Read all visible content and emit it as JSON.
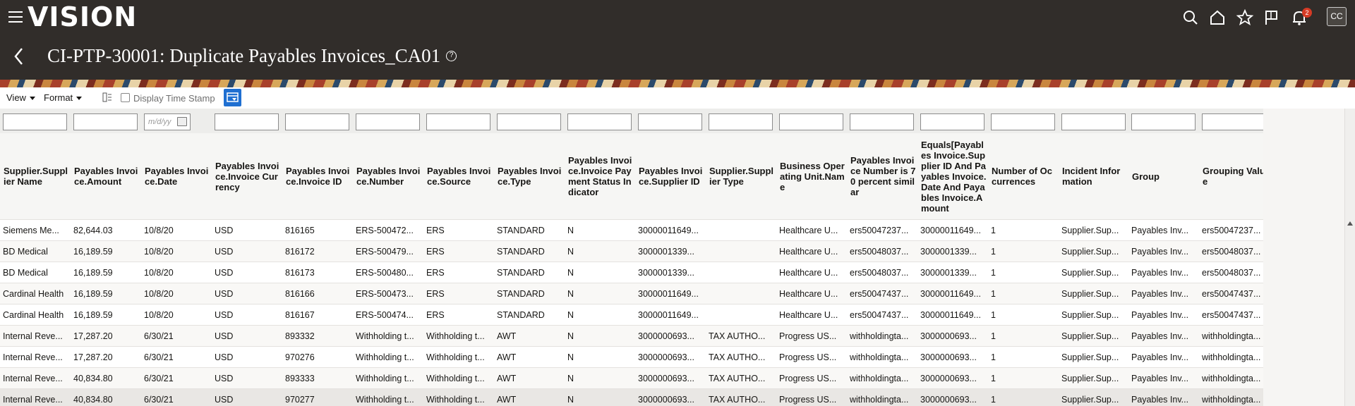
{
  "header": {
    "logo": "VISION",
    "title": "CI-PTP-30001: Duplicate Payables Invoices_CA01",
    "help_glyph": "?",
    "notification_count": "2",
    "avatar_initials": "CC"
  },
  "toolbar": {
    "view_label": "View",
    "format_label": "Format",
    "display_timestamp_label": "Display Time Stamp",
    "date_placeholder": "m/d/yy"
  },
  "table": {
    "columns": [
      "Supplier.Supplier Name",
      "Payables Invoice.Amount",
      "Payables Invoice.Date",
      "Payables Invoice.Invoice Currency",
      "Payables Invoice.Invoice ID",
      "Payables Invoice.Number",
      "Payables Invoice.Source",
      "Payables Invoice.Type",
      "Payables Invoice.Invoice Payment Status Indicator",
      "Payables Invoice.Supplier ID",
      "Supplier.Supplier Type",
      "Business Operating Unit.Name",
      "Payables Invoice Number is 70 percent similar",
      "Equals[Payables Invoice.Supplier ID And Payables Invoice.Date And Payables Invoice.Amount",
      "Number of Occurrences",
      "Incident Information",
      "Group",
      "Grouping Value"
    ],
    "rows": [
      [
        "Siemens Me...",
        "82,644.03",
        "10/8/20",
        "USD",
        "816165",
        "ERS-500472...",
        "ERS",
        "STANDARD",
        "N",
        "30000011649...",
        "",
        "Healthcare U...",
        "ers50047237...",
        "30000011649...",
        "1",
        "Supplier.Sup...",
        "Payables Inv...",
        "ers50047237..."
      ],
      [
        "BD Medical",
        "16,189.59",
        "10/8/20",
        "USD",
        "816172",
        "ERS-500479...",
        "ERS",
        "STANDARD",
        "N",
        "3000001339...",
        "",
        "Healthcare U...",
        "ers50048037...",
        "3000001339...",
        "1",
        "Supplier.Sup...",
        "Payables Inv...",
        "ers50048037..."
      ],
      [
        "BD Medical",
        "16,189.59",
        "10/8/20",
        "USD",
        "816173",
        "ERS-500480...",
        "ERS",
        "STANDARD",
        "N",
        "3000001339...",
        "",
        "Healthcare U...",
        "ers50048037...",
        "3000001339...",
        "1",
        "Supplier.Sup...",
        "Payables Inv...",
        "ers50048037..."
      ],
      [
        "Cardinal Health",
        "16,189.59",
        "10/8/20",
        "USD",
        "816166",
        "ERS-500473...",
        "ERS",
        "STANDARD",
        "N",
        "30000011649...",
        "",
        "Healthcare U...",
        "ers50047437...",
        "30000011649...",
        "1",
        "Supplier.Sup...",
        "Payables Inv...",
        "ers50047437..."
      ],
      [
        "Cardinal Health",
        "16,189.59",
        "10/8/20",
        "USD",
        "816167",
        "ERS-500474...",
        "ERS",
        "STANDARD",
        "N",
        "30000011649...",
        "",
        "Healthcare U...",
        "ers50047437...",
        "30000011649...",
        "1",
        "Supplier.Sup...",
        "Payables Inv...",
        "ers50047437..."
      ],
      [
        "Internal Reve...",
        "17,287.20",
        "6/30/21",
        "USD",
        "893332",
        "Withholding t...",
        "Withholding t...",
        "AWT",
        "N",
        "3000000693...",
        "TAX AUTHO...",
        "Progress US...",
        "withholdingta...",
        "3000000693...",
        "1",
        "Supplier.Sup...",
        "Payables Inv...",
        "withholdingta..."
      ],
      [
        "Internal Reve...",
        "17,287.20",
        "6/30/21",
        "USD",
        "970276",
        "Withholding t...",
        "Withholding t...",
        "AWT",
        "N",
        "3000000693...",
        "TAX AUTHO...",
        "Progress US...",
        "withholdingta...",
        "3000000693...",
        "1",
        "Supplier.Sup...",
        "Payables Inv...",
        "withholdingta..."
      ],
      [
        "Internal Reve...",
        "40,834.80",
        "6/30/21",
        "USD",
        "893333",
        "Withholding t...",
        "Withholding t...",
        "AWT",
        "N",
        "3000000693...",
        "TAX AUTHO...",
        "Progress US...",
        "withholdingta...",
        "3000000693...",
        "1",
        "Supplier.Sup...",
        "Payables Inv...",
        "withholdingta..."
      ],
      [
        "Internal Reve...",
        "40,834.80",
        "6/30/21",
        "USD",
        "970277",
        "Withholding t...",
        "Withholding t...",
        "AWT",
        "N",
        "3000000693...",
        "TAX AUTHO...",
        "Progress US...",
        "withholdingta...",
        "3000000693...",
        "1",
        "Supplier.Sup...",
        "Payables Inv...",
        "withholdingta..."
      ]
    ]
  },
  "icons": [
    "menu-icon",
    "search-icon",
    "home-icon",
    "star-icon",
    "flag-icon",
    "bell-icon",
    "back-icon",
    "help-icon",
    "freeze-icon",
    "query-by-example-icon",
    "calendar-icon"
  ]
}
